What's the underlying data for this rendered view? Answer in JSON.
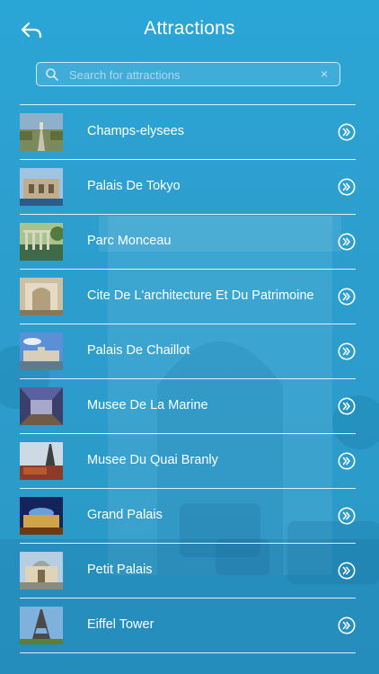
{
  "header": {
    "title": "Attractions",
    "back_icon": "back-arrow-icon"
  },
  "search": {
    "placeholder": "Search for attractions",
    "value": "",
    "clear_glyph": "×"
  },
  "colors": {
    "background": "#2aa6d6",
    "text": "#ffffff",
    "divider": "#ffffff"
  },
  "attractions": [
    {
      "label": "Champs-elysees",
      "thumb": "boulevard"
    },
    {
      "label": "Palais De Tokyo",
      "thumb": "building-courtyard"
    },
    {
      "label": "Parc Monceau",
      "thumb": "park-colonnade"
    },
    {
      "label": "Cite De L'architecture Et Du Patrimoine",
      "thumb": "interior-hall"
    },
    {
      "label": "Palais De Chaillot",
      "thumb": "palace-sky"
    },
    {
      "label": "Musee De La Marine",
      "thumb": "museum-gallery"
    },
    {
      "label": "Musee Du Quai Branly",
      "thumb": "eiffel-museum"
    },
    {
      "label": "Grand Palais",
      "thumb": "palace-night"
    },
    {
      "label": "Petit Palais",
      "thumb": "petit-palais"
    },
    {
      "label": "Eiffel Tower",
      "thumb": "eiffel-tower"
    }
  ]
}
